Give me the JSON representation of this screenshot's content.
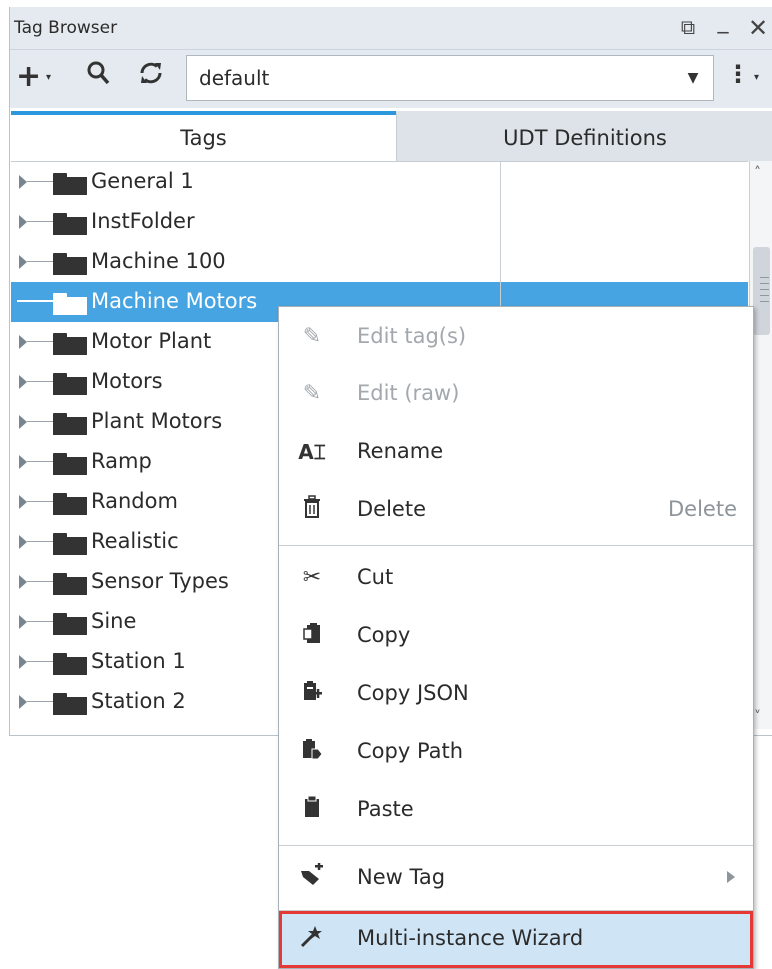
{
  "window": {
    "title": "Tag Browser",
    "restore_icon": "restore-window-icon",
    "minimize_icon": "minimize-icon",
    "close_icon": "close-icon"
  },
  "toolbar": {
    "add_icon": "plus-icon",
    "search_icon": "search-icon",
    "refresh_icon": "refresh-icon",
    "provider_value": "default",
    "more_icon": "vertical-ellipsis-icon"
  },
  "tabs": [
    {
      "label": "Tags",
      "active": true
    },
    {
      "label": "UDT Definitions",
      "active": false
    }
  ],
  "tree": {
    "items": [
      {
        "label": "General 1"
      },
      {
        "label": "InstFolder"
      },
      {
        "label": "Machine 100"
      },
      {
        "label": "Machine Motors",
        "selected": true
      },
      {
        "label": "Motor Plant"
      },
      {
        "label": "Motors"
      },
      {
        "label": "Plant Motors"
      },
      {
        "label": "Ramp"
      },
      {
        "label": "Random"
      },
      {
        "label": "Realistic"
      },
      {
        "label": "Sensor Types"
      },
      {
        "label": "Sine"
      },
      {
        "label": "Station 1"
      },
      {
        "label": "Station 2"
      }
    ]
  },
  "context_menu": {
    "items": [
      {
        "label": "Edit tag(s)",
        "icon": "pencil-icon",
        "disabled": true
      },
      {
        "label": "Edit (raw)",
        "icon": "pencil-icon",
        "disabled": true
      },
      {
        "label": "Rename",
        "icon": "rename-icon"
      },
      {
        "label": "Delete",
        "icon": "trash-icon",
        "accelerator": "Delete"
      },
      {
        "label": "Cut",
        "icon": "scissors-icon"
      },
      {
        "label": "Copy",
        "icon": "copy-icon"
      },
      {
        "label": "Copy JSON",
        "icon": "copy-json-icon"
      },
      {
        "label": "Copy Path",
        "icon": "copy-path-icon"
      },
      {
        "label": "Paste",
        "icon": "clipboard-icon"
      },
      {
        "label": "New Tag",
        "icon": "new-tag-icon",
        "submenu": true
      },
      {
        "label": "Multi-instance Wizard",
        "icon": "magic-wand-icon",
        "highlighted": true
      }
    ]
  },
  "colors": {
    "selection": "#47a4e2",
    "active_tab_accent": "#2b97dd",
    "highlight_outline": "#e53935",
    "highlight_fill": "#cfe4f5"
  }
}
